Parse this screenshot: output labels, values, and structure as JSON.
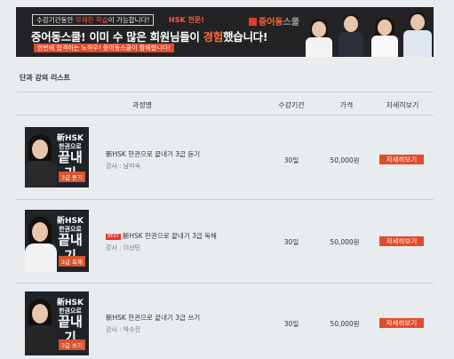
{
  "banner": {
    "free_prefix": "수강기간동안 ",
    "free_highlight": "무제한 학습",
    "free_suffix": "이 가능합니다!",
    "hsk_tag": "HSK 전문!",
    "brand_name": "중어동",
    "brand_suffix": "스쿨",
    "headline_start": "중어동스쿨! 이미 수 많은 회원님들이 ",
    "headline_emph": "경험",
    "headline_end": "했습니다!",
    "subline": "한번에 합격하는 노하우! 중어동스쿨이 함께합니다!"
  },
  "section_title": "단과 강의 리스트",
  "table": {
    "headers": {
      "course": "과정명",
      "period": "수강기간",
      "price": "가격",
      "detail": "자세히보기"
    },
    "rows": [
      {
        "thumb": {
          "line1": "新HSK",
          "line2": "한권으로",
          "line3": "끝내기",
          "level": "3급 듣기"
        },
        "badge": "",
        "title": "新HSK 한권으로 끝내기 3급 듣기",
        "teacher": "강사 : 남미숙",
        "period": "30일",
        "price": "50,000원",
        "detail": "자세히보기"
      },
      {
        "thumb": {
          "line1": "新HSK",
          "line2": "한권으로",
          "line3": "끝내기",
          "level": "3급 독해"
        },
        "badge": "BEST",
        "title": "新HSK 한권으로 끝내기 3급 독해",
        "teacher": "강사 : 이선민",
        "period": "30일",
        "price": "50,000원",
        "detail": "자세히보기"
      },
      {
        "thumb": {
          "line1": "新HSK",
          "line2": "한권으로",
          "line3": "끝내기",
          "level": "3급 쓰기"
        },
        "badge": "",
        "title": "新HSK 한권으로 끝내기 3급 쓰기",
        "teacher": "강사 : 박수진",
        "period": "30일",
        "price": "50,000원",
        "detail": "자세히보기"
      }
    ]
  },
  "colors": {
    "accent": "#e14b2a",
    "banner_bg": "#232325",
    "page_bg": "#e9ecef"
  }
}
